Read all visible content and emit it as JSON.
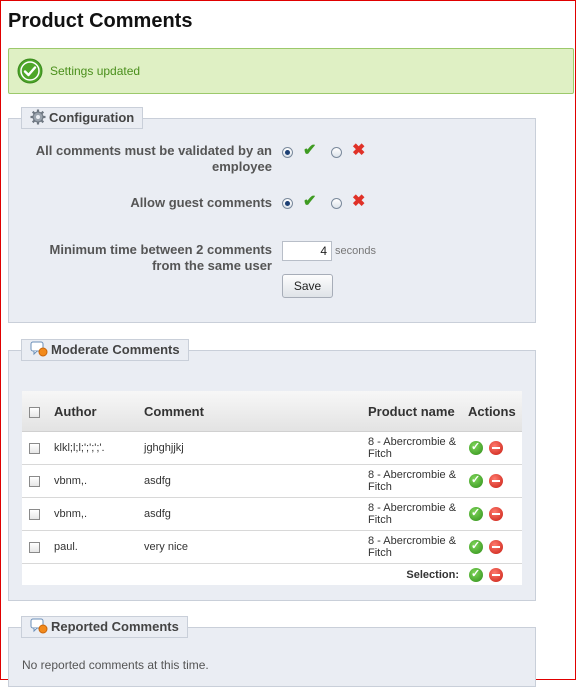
{
  "page": {
    "title": "Product Comments"
  },
  "notice": {
    "text": "Settings updated",
    "icon": "check-circle-icon",
    "color": "#4a8f1c"
  },
  "configuration": {
    "legend": "Configuration",
    "validate": {
      "label": "All comments must be validated by an employee",
      "value": "yes"
    },
    "guest": {
      "label": "Allow guest comments",
      "value": "yes"
    },
    "min_time": {
      "label": "Minimum time between 2 comments from the same user",
      "value": "4",
      "unit": "seconds"
    },
    "save_label": "Save"
  },
  "moderate": {
    "legend": "Moderate Comments",
    "columns": {
      "author": "Author",
      "comment": "Comment",
      "product": "Product name",
      "actions": "Actions"
    },
    "rows": [
      {
        "author": "klkl;l;l;';';';'.",
        "comment": "jghghjjkj",
        "product": "8 - Abercrombie & Fitch"
      },
      {
        "author": "vbnm,.",
        "comment": "asdfg",
        "product": "8 - Abercrombie & Fitch"
      },
      {
        "author": "vbnm,.",
        "comment": "asdfg",
        "product": "8 - Abercrombie & Fitch"
      },
      {
        "author": "paul.",
        "comment": "very nice",
        "product": "8 - Abercrombie & Fitch"
      }
    ],
    "selection_label": "Selection:"
  },
  "reported": {
    "legend": "Reported Comments",
    "empty_text": "No reported comments at this time."
  },
  "colors": {
    "accept": "#3f9b22",
    "reject": "#e03127",
    "panel": "#eaedf3"
  }
}
